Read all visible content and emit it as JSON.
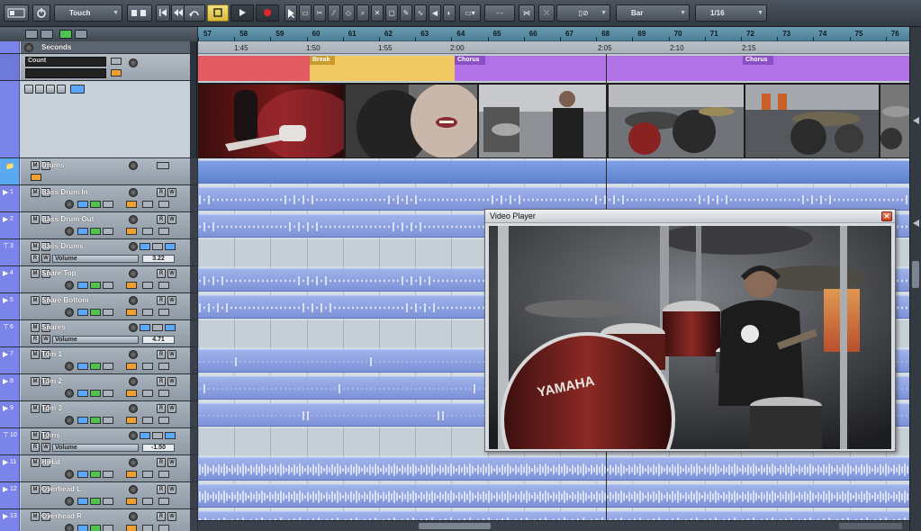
{
  "toolbar": {
    "automation_mode": "Touch",
    "snap_type": "Bar",
    "quantize": "1/16"
  },
  "ruler": {
    "bars": [
      "57",
      "58",
      "59",
      "60",
      "61",
      "62",
      "63",
      "64",
      "65",
      "66",
      "67",
      "68",
      "69",
      "70",
      "71",
      "72",
      "73",
      "74",
      "75",
      "76"
    ],
    "times": [
      "1:45",
      "1:50",
      "1:55",
      "2:00",
      "2:05",
      "2:10",
      "2:15"
    ]
  },
  "markers": [
    {
      "label": "Break",
      "color": "#f1ca63"
    },
    {
      "label": "Chorus",
      "color": "#b072e4"
    },
    {
      "label": "Chorus",
      "color": "#b072e4"
    }
  ],
  "left": {
    "ruler_track": {
      "name": "Seconds"
    },
    "signature_track": {
      "value": "Count"
    }
  },
  "tracks": [
    {
      "num": "",
      "name": "Drums",
      "type": "folder"
    },
    {
      "num": "1",
      "name": "Bass Drum In",
      "type": "audio"
    },
    {
      "num": "2",
      "name": "Bass Drum Out",
      "type": "audio"
    },
    {
      "num": "3",
      "name": "Bass Drums",
      "type": "group",
      "vol_label": "Volume",
      "vol_value": "3.22"
    },
    {
      "num": "4",
      "name": "Snare Top",
      "type": "audio"
    },
    {
      "num": "5",
      "name": "Snare Bottom",
      "type": "audio"
    },
    {
      "num": "6",
      "name": "Snares",
      "type": "group",
      "vol_label": "Volume",
      "vol_value": "4.71"
    },
    {
      "num": "7",
      "name": "Tom 1",
      "type": "audio"
    },
    {
      "num": "8",
      "name": "Tom 2",
      "type": "audio"
    },
    {
      "num": "9",
      "name": "Tom 3",
      "type": "audio"
    },
    {
      "num": "10",
      "name": "Toms",
      "type": "group",
      "vol_label": "Volume",
      "vol_value": "-1.50"
    },
    {
      "num": "11",
      "name": "HiHat",
      "type": "audio"
    },
    {
      "num": "12",
      "name": "Overhead L",
      "type": "audio"
    },
    {
      "num": "13",
      "name": "Overhead R",
      "type": "audio"
    }
  ],
  "video_player": {
    "title": "Video Player",
    "drum_brand": "YAMAHA"
  },
  "colors": {
    "accent": "#7b84e8",
    "audio_event": "#8da2e2",
    "break_marker": "#f1ca63",
    "chorus_marker": "#b072e4"
  }
}
